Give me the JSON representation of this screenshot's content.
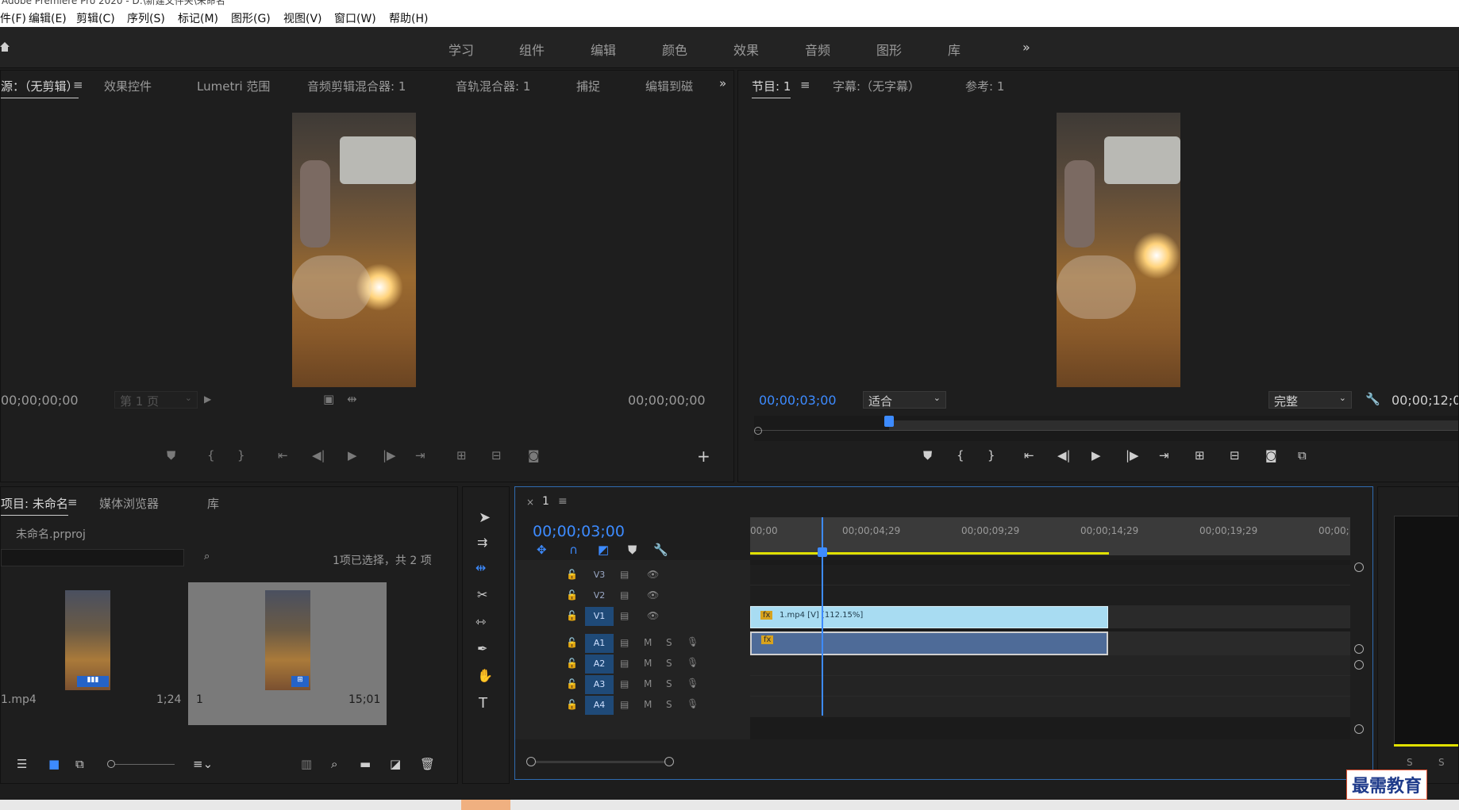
{
  "window": {
    "title": "Adobe Premiere Pro 2020 - D:\\新建文件夹\\未命名"
  },
  "menu": [
    "件(F)",
    "编辑(E)",
    "剪辑(C)",
    "序列(S)",
    "标记(M)",
    "图形(G)",
    "视图(V)",
    "窗口(W)",
    "帮助(H)"
  ],
  "workspaces": [
    "学习",
    "组件",
    "编辑",
    "颜色",
    "效果",
    "音频",
    "图形",
    "库"
  ],
  "source_panel": {
    "tabs": [
      "源：（无剪辑）",
      "效果控件",
      "Lumetri 范围",
      "音频剪辑混合器: 1",
      "音轨混合器: 1",
      "捕捉",
      "编辑到磁"
    ],
    "timecode_in": "00;00;00;00",
    "page_select": "第 1 页",
    "timecode_out": "00;00;00;00"
  },
  "program_panel": {
    "tabs": [
      "节目: 1",
      "字幕:（无字幕）",
      "参考: 1"
    ],
    "timecode": "00;00;03;00",
    "zoom_select": "适合",
    "quality_select": "完整",
    "duration": "00;00;12;0"
  },
  "project_panel": {
    "tabs": [
      "项目: 未命名",
      "媒体浏览器",
      "库"
    ],
    "file": "未命名.prproj",
    "search_placeholder": "",
    "selection_info": "1项已选择，共 2 项",
    "items": [
      {
        "name": "1.mp4",
        "duration": "1;24"
      },
      {
        "name": "1",
        "duration": "15;01"
      }
    ]
  },
  "timeline": {
    "sequence_name": "1",
    "timecode": "00;00;03;00",
    "ruler": [
      "00;00",
      "00;00;04;29",
      "00;00;09;29",
      "00;00;14;29",
      "00;00;19;29",
      "00;00;"
    ],
    "video_tracks": [
      "V3",
      "V2",
      "V1"
    ],
    "audio_tracks": [
      "A1",
      "A2",
      "A3",
      "A4"
    ],
    "clip_label": "1.mp4 [V] [112.15%]",
    "fx": "fx",
    "m": "M",
    "s": "S"
  },
  "meter_labels": [
    "S",
    "S"
  ],
  "watermark": "最需教育"
}
